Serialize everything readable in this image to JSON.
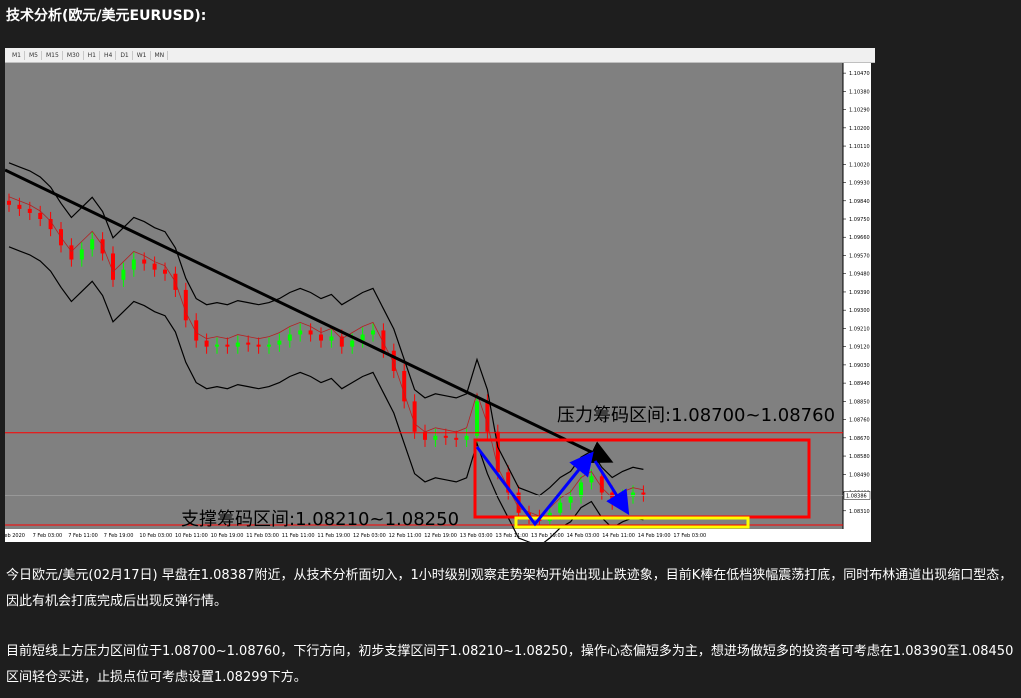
{
  "page": {
    "title": "技术分析(欧元/美元EURUSD):",
    "paragraphs": [
      "今日欧元/美元(02月17日) 早盘在1.08387附近，从技术分析面切入，1小时级别观察走势架构开始出现止跌迹象，目前K棒在低档狭幅震荡打底，同时布林通道出现缩口型态，因此有机会打底完成后出现反弹行情。",
      "目前短线上方压力区间位于1.08700~1.08760，下行方向，初步支撑区间于1.08210~1.08250，操作心态偏短多为主，想进场做短多的投资者可考虑在1.08390至1.08450区间轻仓买进，止损点位可考虑设置1.08299下方。"
    ]
  },
  "toolbar": {
    "timeframes": [
      "M1",
      "M5",
      "M15",
      "M30",
      "H1",
      "H4",
      "D1",
      "W1",
      "MN"
    ]
  },
  "chart_data": {
    "type": "line",
    "symbol": "EURUSD",
    "series_kind": "candlestick with Bollinger bands",
    "y_ticks": [
      "1.10470",
      "1.10380",
      "1.10290",
      "1.10200",
      "1.10110",
      "1.10020",
      "1.09930",
      "1.09840",
      "1.09750",
      "1.09660",
      "1.09570",
      "1.09480",
      "1.09390",
      "1.09300",
      "1.09210",
      "1.09120",
      "1.09030",
      "1.08940",
      "1.08850",
      "1.08760",
      "1.08670",
      "1.08580",
      "1.08490",
      "1.08400",
      "1.08310"
    ],
    "ylim": [
      1.0822,
      1.1052
    ],
    "current_price_label": "1.08386",
    "x_ticks": [
      "7 Feb 2020",
      "7 Feb 03:00",
      "7 Feb 11:00",
      "7 Feb 19:00",
      "10 Feb 03:00",
      "10 Feb 11:00",
      "10 Feb 19:00",
      "11 Feb 03:00",
      "11 Feb 11:00",
      "11 Feb 19:00",
      "12 Feb 03:00",
      "12 Feb 11:00",
      "12 Feb 19:00",
      "13 Feb 03:00",
      "13 Feb 11:00",
      "13 Feb 19:00",
      "14 Feb 03:00",
      "14 Feb 11:00",
      "14 Feb 19:00",
      "17 Feb 03:00"
    ],
    "close_prices": [
      1.0982,
      1.098,
      1.0978,
      1.0975,
      1.097,
      1.0962,
      1.0955,
      1.096,
      1.0965,
      1.0958,
      1.0945,
      1.095,
      1.0955,
      1.0953,
      1.095,
      1.0948,
      1.094,
      1.0925,
      1.0915,
      1.0912,
      1.0913,
      1.0912,
      1.0914,
      1.0913,
      1.0912,
      1.0913,
      1.0915,
      1.0918,
      1.092,
      1.0918,
      1.0915,
      1.0917,
      1.0912,
      1.0915,
      1.0918,
      1.092,
      1.091,
      1.09,
      1.0885,
      1.087,
      1.0866,
      1.0868,
      1.0867,
      1.0866,
      1.0868,
      1.0885,
      1.087,
      1.085,
      1.084,
      1.083,
      1.0828,
      1.0826,
      1.083,
      1.0835,
      1.0838,
      1.0845,
      1.0848,
      1.084,
      1.0835,
      1.0838,
      1.084,
      1.0839
    ],
    "annotations": {
      "resistance_label": "压力筹码区间:1.08700~1.08760",
      "support_label": "支撑筹码区间:1.08210~1.08250"
    },
    "colors": {
      "background": "#808080",
      "bull_candle": "#00ff00",
      "bear_candle": "#ff0000",
      "bands": "#000000",
      "trendline": "#000000",
      "resistance_box": "#ff0000",
      "support_box": "#ffff00",
      "arrows": "#0000ff",
      "hline": "#ff0000"
    }
  }
}
